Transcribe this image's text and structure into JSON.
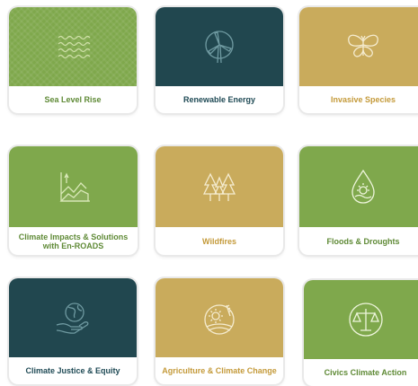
{
  "cards": [
    {
      "label": "Sea Level Rise",
      "icon": "waves-icon",
      "bg": "#7fa84c",
      "text": "#5f8a36"
    },
    {
      "label": "Renewable Energy",
      "icon": "wind-turbine-icon",
      "bg": "#21474f",
      "text": "#1f4a55"
    },
    {
      "label": "Invasive Species",
      "icon": "butterfly-icon",
      "bg": "#c9ab5c",
      "text": "#c49a3a"
    },
    {
      "label": "Climate Impacts & Solutions with En-ROADS",
      "icon": "chart-icon",
      "bg": "#7fa84c",
      "text": "#5f8a36"
    },
    {
      "label": "Wildfires",
      "icon": "burning-trees-icon",
      "bg": "#c9ab5c",
      "text": "#c49a3a"
    },
    {
      "label": "Floods & Droughts",
      "icon": "water-drop-icon",
      "bg": "#7fa84c",
      "text": "#5f8a36"
    },
    {
      "label": "Climate Justice & Equity",
      "icon": "hand-globe-icon",
      "bg": "#21474f",
      "text": "#1f4a55"
    },
    {
      "label": "Agriculture & Climate Change",
      "icon": "sun-wheat-icon",
      "bg": "#c9ab5c",
      "text": "#c49a3a"
    },
    {
      "label": "Civics Climate Action",
      "icon": "scales-of-justice-icon",
      "bg": "#7fa84c",
      "text": "#5f8a36"
    }
  ]
}
